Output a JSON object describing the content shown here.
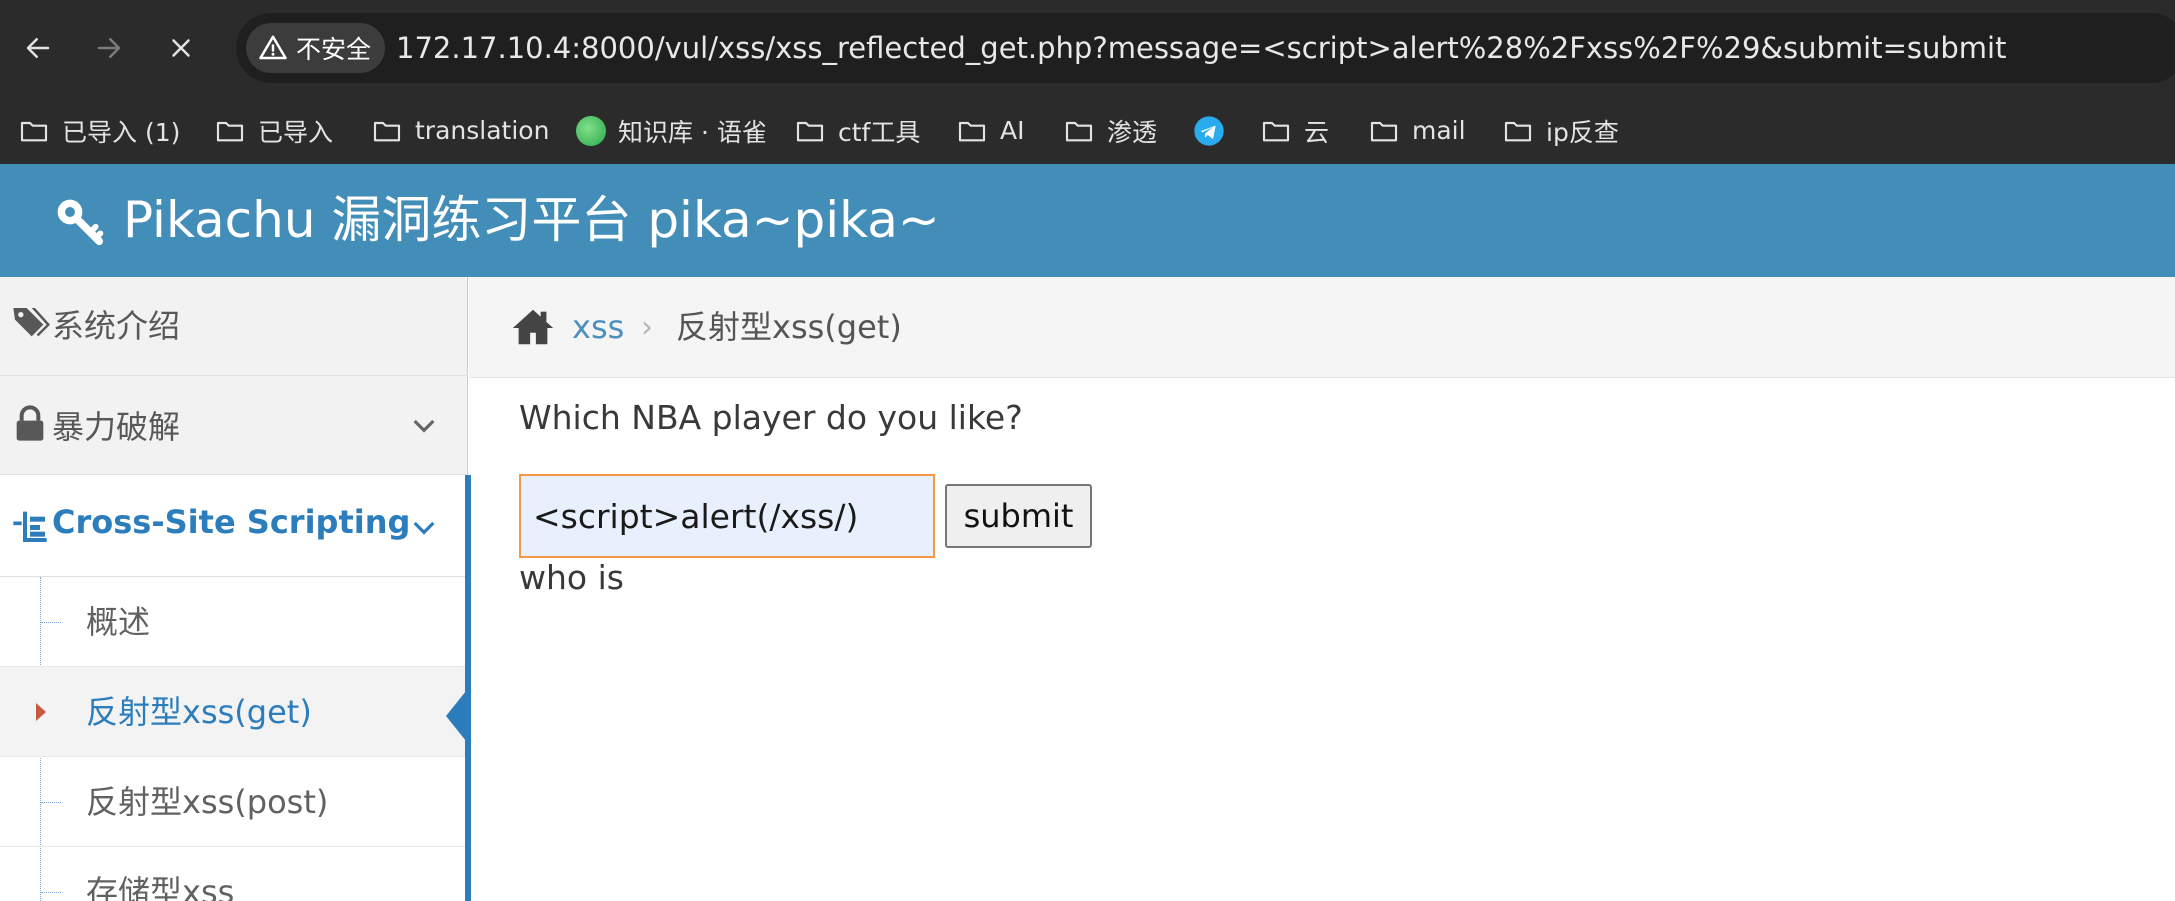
{
  "browser": {
    "security_label": "不安全",
    "url": "172.17.10.4:8000/vul/xss/xss_reflected_get.php?message=<script>alert%28%2Fxss%2F%29&submit=submit",
    "bookmarks": [
      {
        "label": "已导入 (1)",
        "icon": "folder-icon"
      },
      {
        "label": "已导入",
        "icon": "folder-icon"
      },
      {
        "label": "translation",
        "icon": "folder-icon"
      },
      {
        "label": "知识库 · 语雀",
        "icon": "yuque-icon"
      },
      {
        "label": "ctf工具",
        "icon": "folder-icon"
      },
      {
        "label": "AI",
        "icon": "folder-icon"
      },
      {
        "label": "渗透",
        "icon": "folder-icon"
      },
      {
        "label": "",
        "icon": "telegram-icon"
      },
      {
        "label": "云",
        "icon": "folder-icon"
      },
      {
        "label": "mail",
        "icon": "folder-icon"
      },
      {
        "label": "ip反查",
        "icon": "folder-icon"
      }
    ]
  },
  "app": {
    "title": "Pikachu 漏洞练习平台 pika~pika~",
    "header_color": "#438eb9"
  },
  "sidebar": {
    "items": [
      {
        "label": "系统介绍",
        "icon": "tags-icon"
      },
      {
        "label": "暴力破解",
        "icon": "lock-icon"
      },
      {
        "label": "Cross-Site Scripting",
        "icon": "list-tree-icon"
      }
    ],
    "subitems": [
      {
        "label": "概述"
      },
      {
        "label": "反射型xss(get)"
      },
      {
        "label": "反射型xss(post)"
      },
      {
        "label": "存储型xss"
      }
    ],
    "accent_color": "#2b7dbc"
  },
  "breadcrumb": {
    "parent": "xss",
    "separator": "›",
    "current": "反射型xss(get)"
  },
  "form": {
    "question": "Which NBA player do you like?",
    "input_value": "<script>alert(/xss/)",
    "submit_label": "submit",
    "result": "who is"
  }
}
